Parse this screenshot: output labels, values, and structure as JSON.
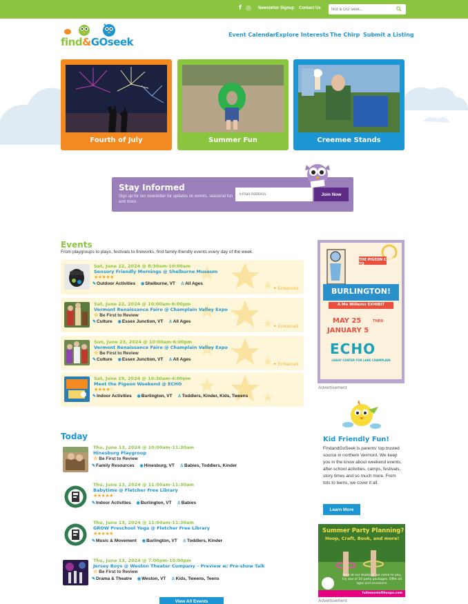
{
  "topbar": {
    "newsletter_signup": "Newsletter Signup",
    "contact_us": "Contact Us",
    "search_placeholder": "find & GO seek...",
    "facebook_glyph": "f",
    "instagram_glyph": "◎"
  },
  "brand": {
    "logo_text_find": "find",
    "logo_text_amp": "&",
    "logo_text_go": "GO",
    "logo_text_seek": "seek",
    "green": "#8bc53f",
    "blue": "#1c95d3",
    "orange": "#f28a21",
    "purple": "#9a7fba"
  },
  "nav": {
    "items": [
      "Event Calendar",
      "Explore Interests",
      "The Chirp",
      "Submit a Listing"
    ]
  },
  "hero": {
    "tiles": [
      {
        "label": "Fourth of July",
        "color": "#f28a21"
      },
      {
        "label": "Summer Fun",
        "color": "#8bc53f"
      },
      {
        "label": "Creemee Stands",
        "color": "#1c95d3"
      }
    ]
  },
  "newsletter": {
    "title": "Stay Informed",
    "subtitle": "Sign up for our newsletter for updates on events, seasonal fun and more.",
    "email_placeholder": "Email Address",
    "join_label": "Join Now"
  },
  "events": {
    "title": "Events",
    "subtitle": "From playgroups to plays, festivals to fireworks, find family-friendly events every day of the week.",
    "enhanced_label": "Enhanced",
    "items": [
      {
        "date": "Sat, June 22, 2024 @ 8:30am-10:00am",
        "name": "Sensory Friendly Mornings @ Shelburne Museum",
        "rating": "★★★★★",
        "review": "",
        "interest": "Outdoor Activities",
        "location": "Shelburne, VT",
        "ages": "All Ages"
      },
      {
        "date": "Sat, June 22, 2024 @ 10:00am-6:00pm",
        "name": "Vermont Renaissance Faire @ Champlain Valley Expo",
        "rating": "",
        "review": "Be First to Review",
        "interest": "Culture",
        "location": "Essex Junction, VT",
        "ages": "All Ages"
      },
      {
        "date": "Sun, June 23, 2024 @ 10:00am-6:00pm",
        "name": "Vermont Renaissance Faire @ Champlain Valley Expo",
        "rating": "",
        "review": "Be First to Review",
        "interest": "Culture",
        "location": "Essex Junction, VT",
        "ages": "All Ages"
      },
      {
        "date": "Sat, June 29, 2024 @ 10:30am-4:00pm",
        "name": "Meet the Pigeon Weekend @ ECHO",
        "rating": "★★★★☆",
        "review": "",
        "interest": "Indoor Activities",
        "location": "Burlington, VT",
        "ages": "Toddlers, Kinder, Kids, Tweens"
      }
    ]
  },
  "today": {
    "title": "Today",
    "items": [
      {
        "date": "Thu, June 13, 2024 @ 10:00am-11:30am",
        "name": "Hinesburg Playgroup",
        "rating": "",
        "review": "Be First to Review",
        "interest": "Family Resources",
        "location": "Hinesburg, VT",
        "ages": "Babies, Toddlers, Kinder"
      },
      {
        "date": "Thu, June 13, 2024 @ 11:00am-11:30am",
        "name": "Babytime @ Fletcher Free Library",
        "rating": "★★★★★",
        "review": "",
        "interest": "Indoor Activities",
        "location": "Burlington, VT",
        "ages": "Babies"
      },
      {
        "date": "Thu, June 13, 2024 @ 11:00am-11:30am",
        "name": "GROW Preschool Yoga @ Fletcher Free Library",
        "rating": "★★★★★",
        "review": "",
        "interest": "Music & Movement",
        "location": "Burlington, VT",
        "ages": "Toddlers, Kinder"
      },
      {
        "date": "Thu, June 13, 2024 @ 7:00pm-10:00pm",
        "name": "Jersey Boys @ Weston Theater Company – Preview w/ Pre-show Talk",
        "rating": "",
        "review": "Be First to Review",
        "interest": "Drama & Theatre",
        "location": "Weston, VT",
        "ages": "Kids, Tweens, Teens"
      }
    ],
    "view_all": "View All Events"
  },
  "sidebar": {
    "ad1": {
      "line1": "THE PIGEON COMES TO",
      "line2": "BURLINGTON!",
      "line3": "A Mo Willems EXHIBIT",
      "dates1": "MAY 25",
      "thru": "THRU",
      "dates2": "JANUARY 5",
      "org": "ECHO",
      "org_sub": "LEAHY CENTER FOR LAKE CHAMPLAIN"
    },
    "ad_label": "Advertisement",
    "kid_friendly": {
      "title": "Kid Friendly Fun!",
      "body": "FindandGoSeek is parents' top trusted source in northern Vermont. We keep you in the know about weekend events, after-school activities, camps, festivals, story times and so much more. From tots to teens, we cover it all.",
      "button": "Learn More"
    },
    "ad2": {
      "title": "Summer Party Planning?",
      "subtitle": "Hoop, Craft, Book, and more!",
      "body": "Rent at our studio or we come to you, try one of 10 party packages. Offer all ages and occasions.",
      "url": "fullmoonlofthoops.com"
    }
  }
}
